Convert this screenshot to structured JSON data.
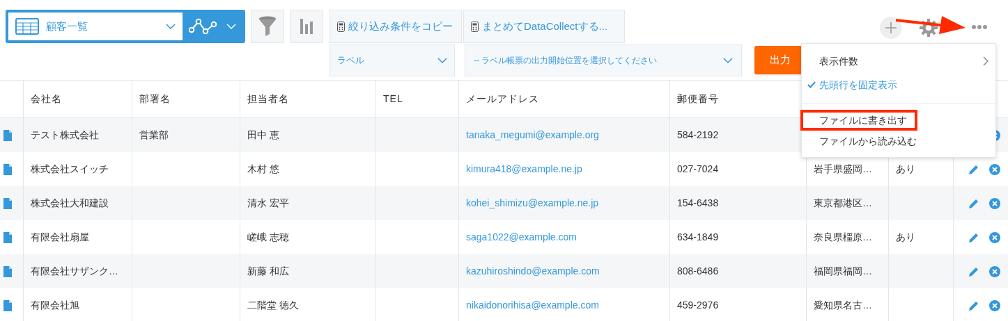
{
  "view_selector": {
    "label": "顧客一覧"
  },
  "toolbar": {
    "copy_filter": "絞り込み条件をコピー",
    "datacollect": "まとめてDataCollectする...",
    "label_select": "ラベル",
    "position_select": "-- ラベル帳票の出力開始位置を選択してください",
    "output_button": "出力"
  },
  "menu": {
    "sections": [
      [
        {
          "label": "表示件数",
          "kind": "submenu"
        },
        {
          "label": "先頭行を固定表示",
          "kind": "toggle",
          "checked": true
        }
      ],
      [
        {
          "label": "ファイルに書き出す",
          "kind": "action",
          "highlighted": true
        },
        {
          "label": "ファイルから読み込む",
          "kind": "action",
          "highlighted": false
        }
      ]
    ]
  },
  "table": {
    "columns": [
      "会社名",
      "部署名",
      "担当者名",
      "TEL",
      "メールアドレス",
      "郵便番号"
    ],
    "rows": [
      {
        "company": "テスト株式会社",
        "department": "営業部",
        "contact": "田中 恵",
        "email": "tanaka_megumi@example.org",
        "zip": "584-2192",
        "actions": [
          {
            "kind": "delete"
          }
        ]
      },
      {
        "company": "株式会社スイッチ",
        "contact": "木村 悠",
        "email": "kimura418@example.ne.jp",
        "zip": "027-7024",
        "address": "岩手県盛岡…",
        "column_8": "あり",
        "actions": [
          {
            "kind": "edit"
          },
          {
            "kind": "delete"
          }
        ]
      },
      {
        "company": "株式会社大和建設",
        "contact": "清水 宏平",
        "email": "kohei_shimizu@example.ne.jp",
        "zip": "154-6438",
        "address": "東京都港区…",
        "actions": [
          {
            "kind": "edit"
          },
          {
            "kind": "delete"
          }
        ]
      },
      {
        "company": "有限会社扇屋",
        "contact": "嵯峨 志穂",
        "email": "saga1022@example.com",
        "zip": "634-1849",
        "address": "奈良県橿原…",
        "column_8": "あり",
        "actions": [
          {
            "kind": "edit"
          },
          {
            "kind": "delete"
          }
        ]
      },
      {
        "company": "有限会社サザンク…",
        "contact": "新藤 和広",
        "email": "kazuhiroshindo@example.com",
        "zip": "808-6486",
        "address": "福岡県福岡…",
        "actions": [
          {
            "kind": "edit"
          },
          {
            "kind": "delete"
          }
        ]
      },
      {
        "company": "有限会社旭",
        "contact": "二階堂 徳久",
        "email": "nikaidonorihisa@example.com",
        "zip": "459-2976",
        "address": "愛知県名古…",
        "actions": [
          {
            "kind": "edit"
          },
          {
            "kind": "delete"
          }
        ]
      }
    ]
  }
}
